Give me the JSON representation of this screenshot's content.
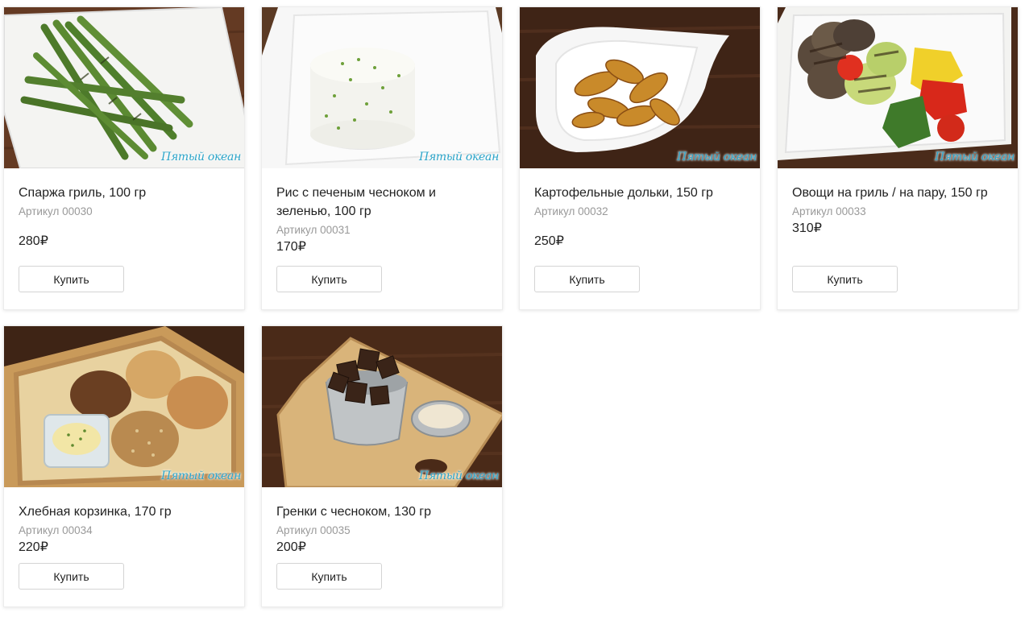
{
  "brand_watermark": "Пятый океан",
  "products": [
    {
      "title": "Спаржа гриль, 100 гр",
      "sku": "Артикул 00030",
      "price": "280₽",
      "buy_label": "Купить"
    },
    {
      "title": "Рис с печеным чесноком и зеленью, 100 гр",
      "sku": "Артикул 00031",
      "price": "170₽",
      "buy_label": "Купить"
    },
    {
      "title": "Картофельные дольки, 150 гр",
      "sku": "Артикул 00032",
      "price": "250₽",
      "buy_label": "Купить"
    },
    {
      "title": "Овощи на гриль / на пару, 150 гр",
      "sku": "Артикул 00033",
      "price": "310₽",
      "buy_label": "Купить"
    },
    {
      "title": "Хлебная корзинка, 170 гр",
      "sku": "Артикул 00034",
      "price": "220₽",
      "buy_label": "Купить"
    },
    {
      "title": "Гренки с чесноком, 130 гр",
      "sku": "Артикул 00035",
      "price": "200₽",
      "buy_label": "Купить"
    }
  ],
  "colors": {
    "accent_watermark": "#2aa4c9",
    "button_border": "#d4d4d4",
    "sku_text": "#999999"
  }
}
